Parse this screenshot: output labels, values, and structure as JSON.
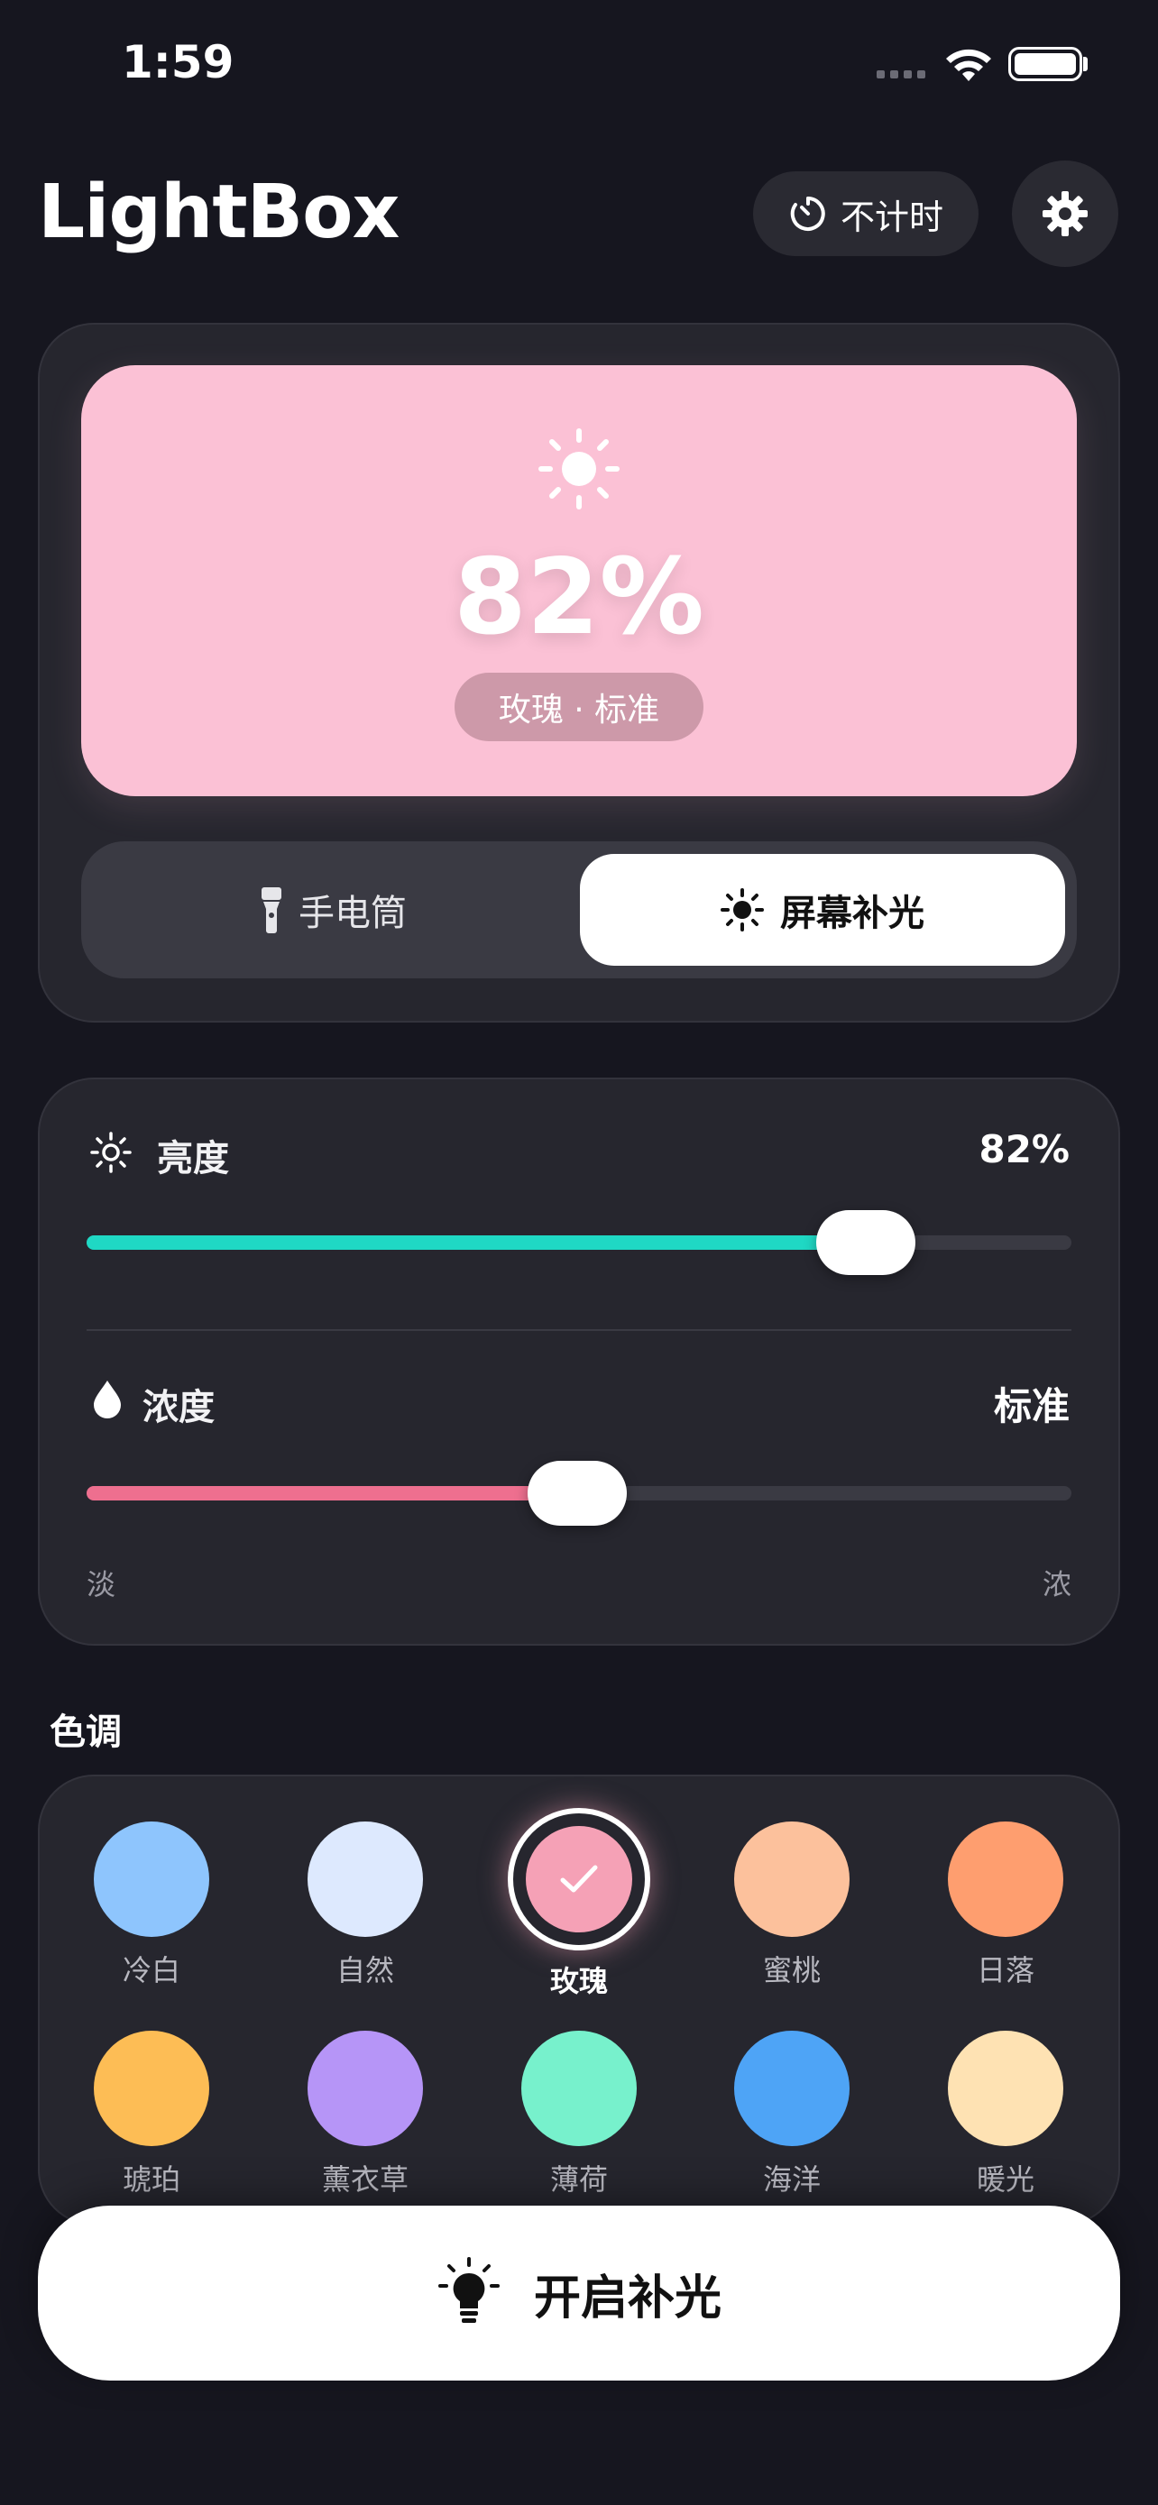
{
  "status": {
    "time": "1:59"
  },
  "header": {
    "title": "LightBox",
    "timer_label": "不计时"
  },
  "preview": {
    "color": "#fbc1d5",
    "brightness_text": "82%",
    "preset_text": "玫瑰 · 标准"
  },
  "mode": {
    "options": [
      {
        "label": "手电筒",
        "icon": "flashlight-icon",
        "selected": false
      },
      {
        "label": "屏幕补光",
        "icon": "sun-icon",
        "selected": true
      }
    ]
  },
  "controls": {
    "brightness": {
      "label": "亮度",
      "value_text": "82%",
      "level": 0.82,
      "color": "#1fd8c4"
    },
    "intensity": {
      "label": "浓度",
      "value_text": "标准",
      "level": 0.5,
      "color": "#ee6f8f",
      "min_label": "淡",
      "max_label": "浓"
    }
  },
  "tones": {
    "title": "色调",
    "items": [
      {
        "label": "冷白",
        "color": "#8ec5fd",
        "selected": false
      },
      {
        "label": "自然",
        "color": "#dde9fe",
        "selected": false
      },
      {
        "label": "玫瑰",
        "color": "#f5a1b6",
        "selected": true
      },
      {
        "label": "蜜桃",
        "color": "#fcc19c",
        "selected": false
      },
      {
        "label": "日落",
        "color": "#fe9e6f",
        "selected": false
      },
      {
        "label": "琥珀",
        "color": "#fdbd55",
        "selected": false
      },
      {
        "label": "薰衣草",
        "color": "#b695f7",
        "selected": false
      },
      {
        "label": "薄荷",
        "color": "#77f1cc",
        "selected": false
      },
      {
        "label": "海洋",
        "color": "#4ea4f6",
        "selected": false
      },
      {
        "label": "暖光",
        "color": "#fee2b3",
        "selected": false
      }
    ]
  },
  "action": {
    "label": "开启补光"
  }
}
